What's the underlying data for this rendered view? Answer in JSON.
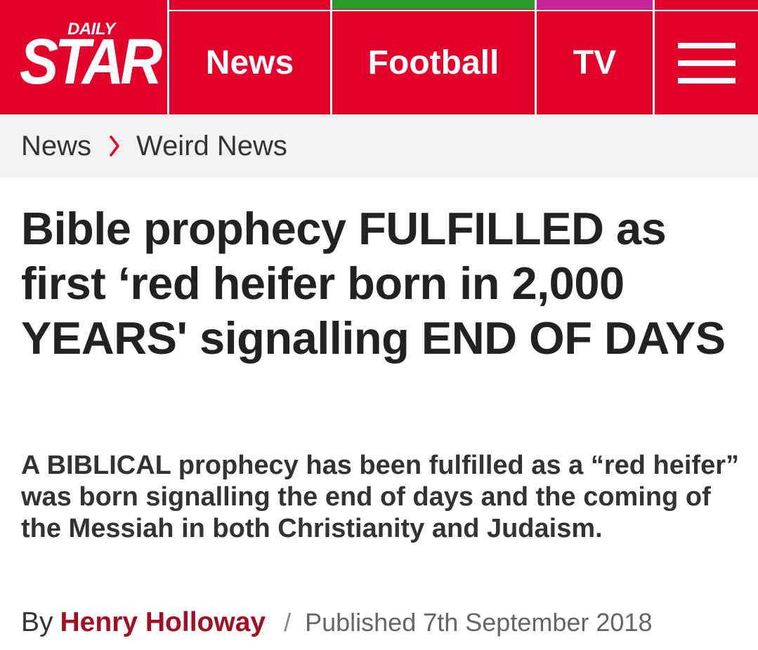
{
  "header": {
    "logo": {
      "daily": "DAILY",
      "star": "STAR"
    },
    "nav": [
      {
        "label": "News",
        "accent": "#e4012a"
      },
      {
        "label": "Football",
        "accent": "#2a9b2a"
      },
      {
        "label": "TV",
        "accent": "#c7249c"
      }
    ],
    "menu_icon": "hamburger-menu-icon",
    "background": "#e4012a"
  },
  "breadcrumb": {
    "items": [
      "News",
      "Weird News"
    ],
    "separator_icon": "chevron-right-icon",
    "separator_color": "#e4012a"
  },
  "article": {
    "headline": "Bible prophecy FULFILLED as first ‘red heifer born in 2,000 YEARS' signalling END OF DAYS",
    "standfirst": "A BIBLICAL prophecy has been fulfilled as a “red heifer” was born signalling the end of days and the coming of the Messiah in both Christianity and Judaism.",
    "byline": {
      "by": "By",
      "author": "Henry Holloway",
      "separator": "/",
      "published": "Published 7th September 2018",
      "author_color": "#a30e22"
    }
  }
}
